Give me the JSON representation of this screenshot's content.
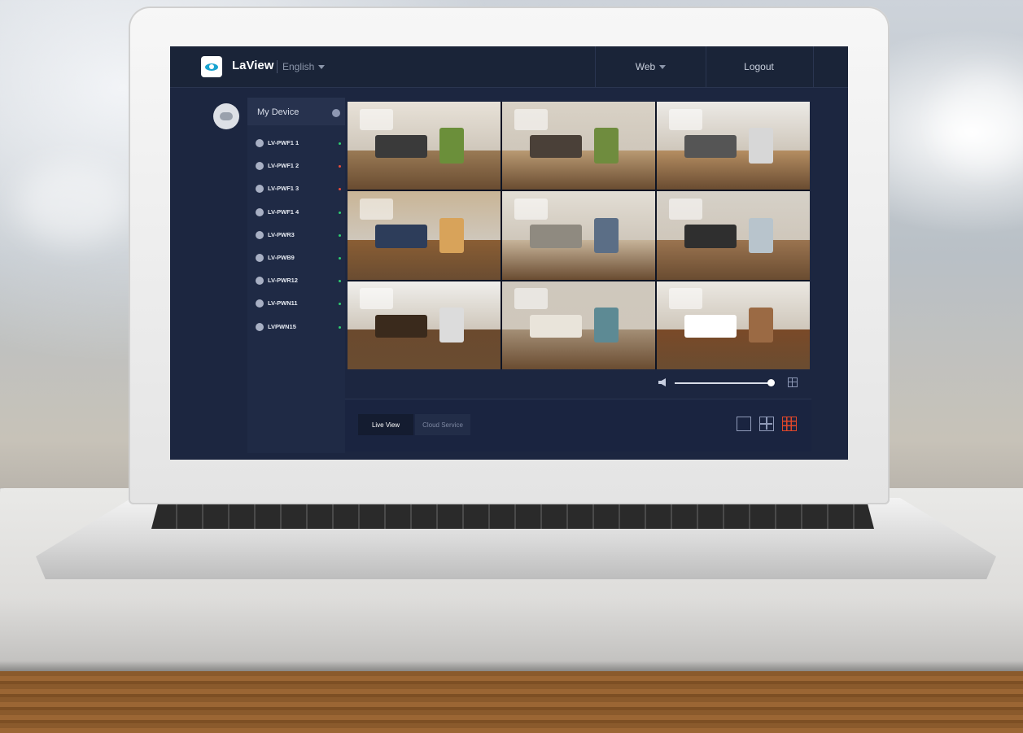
{
  "app": {
    "brand": "LaView",
    "language": "English",
    "menu_web": "Web",
    "logout": "Logout"
  },
  "sidebar": {
    "title": "My Device",
    "devices": [
      {
        "label": "LV-PWF1 1",
        "status_color": "#2ecc71"
      },
      {
        "label": "LV-PWF1 2",
        "status_color": "#e74c3c"
      },
      {
        "label": "LV-PWF1 3",
        "status_color": "#e74c3c"
      },
      {
        "label": "LV-PWF1 4",
        "status_color": "#2ecc71"
      },
      {
        "label": "LV-PWR3",
        "status_color": "#2ecc71"
      },
      {
        "label": "LV-PWB9",
        "status_color": "#2ecc71"
      },
      {
        "label": "LV-PWR12",
        "status_color": "#2ecc71"
      },
      {
        "label": "LV-PWN11",
        "status_color": "#2ecc71"
      },
      {
        "label": "LVPWN15",
        "status_color": "#2ecc71"
      }
    ]
  },
  "tabs": {
    "live": "Live View",
    "cloud": "Cloud Service"
  },
  "player": {
    "volume_fraction": 0.97,
    "active_layout": "9-grid",
    "accent_color": "#e0472a"
  },
  "camera_feeds": [
    {
      "icon": "staircase-living-room"
    },
    {
      "icon": "living-room-tv"
    },
    {
      "icon": "kitchen-dining"
    },
    {
      "icon": "dining-kitchen"
    },
    {
      "icon": "living-room-sofa"
    },
    {
      "icon": "dining-window"
    },
    {
      "icon": "dining-chandelier"
    },
    {
      "icon": "bedroom"
    },
    {
      "icon": "hallway-stairs"
    }
  ]
}
